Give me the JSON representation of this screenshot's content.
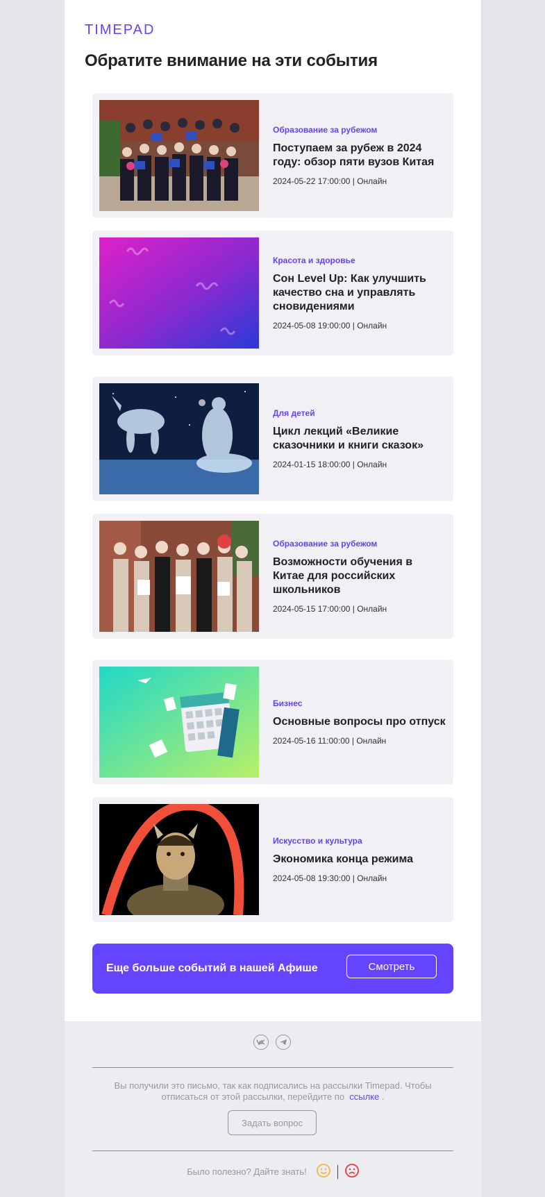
{
  "brand": {
    "logo_text": "TIMEPAD",
    "accent": "#6442f5"
  },
  "heading": "Обратите внимание на эти события",
  "events": [
    {
      "category": "Образование за рубежом",
      "title": "Поступаем за рубеж в 2024 году: обзор пяти вузов Китая",
      "meta": "2024-05-22 17:00:00 | Онлайн",
      "image": "group-photo-students"
    },
    {
      "category": "Красота и здоровье",
      "title": "Сон Level Up: Как улучшить качество сна и управлять сновидениями",
      "meta": "2024-05-08 19:00:00 | Онлайн",
      "image": "purple-gradient"
    },
    {
      "category": "Для детей",
      "title": "Цикл лекций «Великие сказочники и книги сказок»",
      "meta": "2024-01-15 18:00:00 | Онлайн",
      "image": "snow-queen-painting"
    },
    {
      "category": "Образование за рубежом",
      "title": "Возможности обучения в Китае для российских школьников",
      "meta": "2024-05-15 17:00:00 | Онлайн",
      "image": "group-photo-graduates"
    },
    {
      "category": "Бизнес",
      "title": "Основные вопросы про отпуск",
      "meta": "2024-05-16 11:00:00 | Онлайн",
      "image": "calendar-illustration"
    },
    {
      "category": "Искусство и культура",
      "title": "Экономика конца режима",
      "meta": "2024-05-08 19:30:00 | Онлайн",
      "image": "devil-portrait"
    }
  ],
  "banner": {
    "text": "Еще больше событий в нашей Афише",
    "button": "Смотреть"
  },
  "footer": {
    "social": [
      "vk-icon",
      "telegram-icon"
    ],
    "notice": "Вы получили это письмо, так как подписались на рассылки Timepad. Чтобы отписаться от этой рассылки, перейдите по",
    "notice_link": "ссылке",
    "notice_end": ".",
    "ask_button": "Задать вопрос",
    "feedback": "Было полезно? Дайте знать!"
  }
}
